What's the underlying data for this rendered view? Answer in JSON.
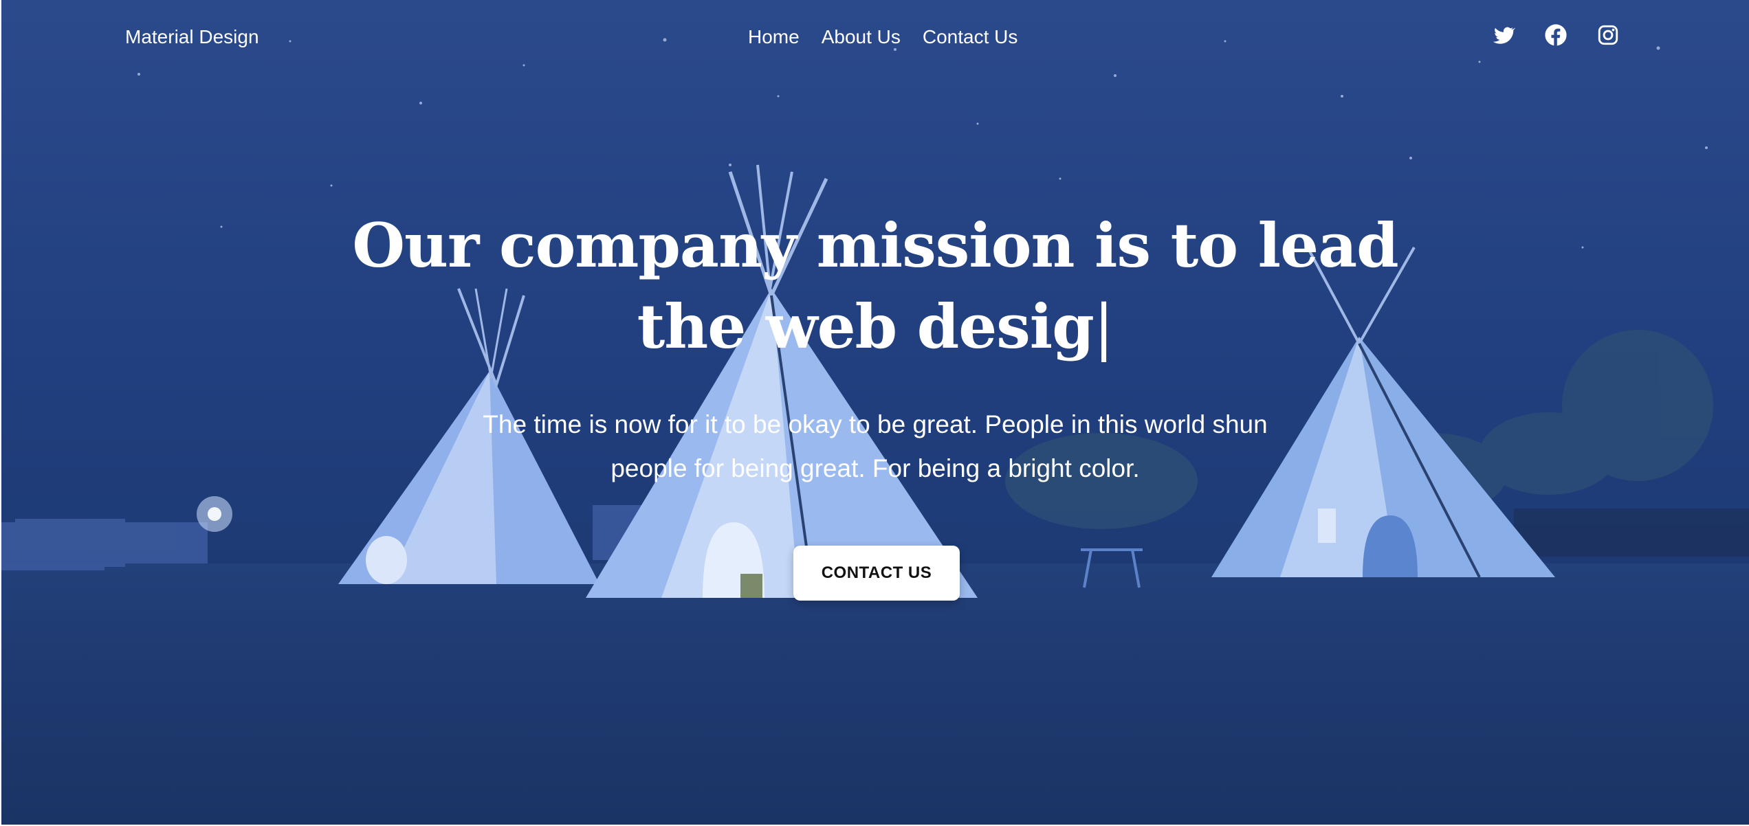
{
  "navbar": {
    "brand": "Material Design",
    "links": [
      {
        "label": "Home"
      },
      {
        "label": "About Us"
      },
      {
        "label": "Contact Us"
      }
    ],
    "social_icons": [
      "twitter-icon",
      "facebook-icon",
      "instagram-icon"
    ]
  },
  "hero": {
    "headline_line1": "Our company mission is to lead",
    "headline_line2": "the web desig",
    "typing_cursor": "|",
    "subtitle_line1": "The time is now for it to be okay to be great. People in this world shun",
    "subtitle_line2": "people for being great. For being a bright color.",
    "cta_label": "CONTACT US"
  },
  "colors": {
    "overlay": "#213f7e",
    "text": "#ffffff",
    "cta_bg": "#ffffff",
    "cta_text": "#111111"
  }
}
